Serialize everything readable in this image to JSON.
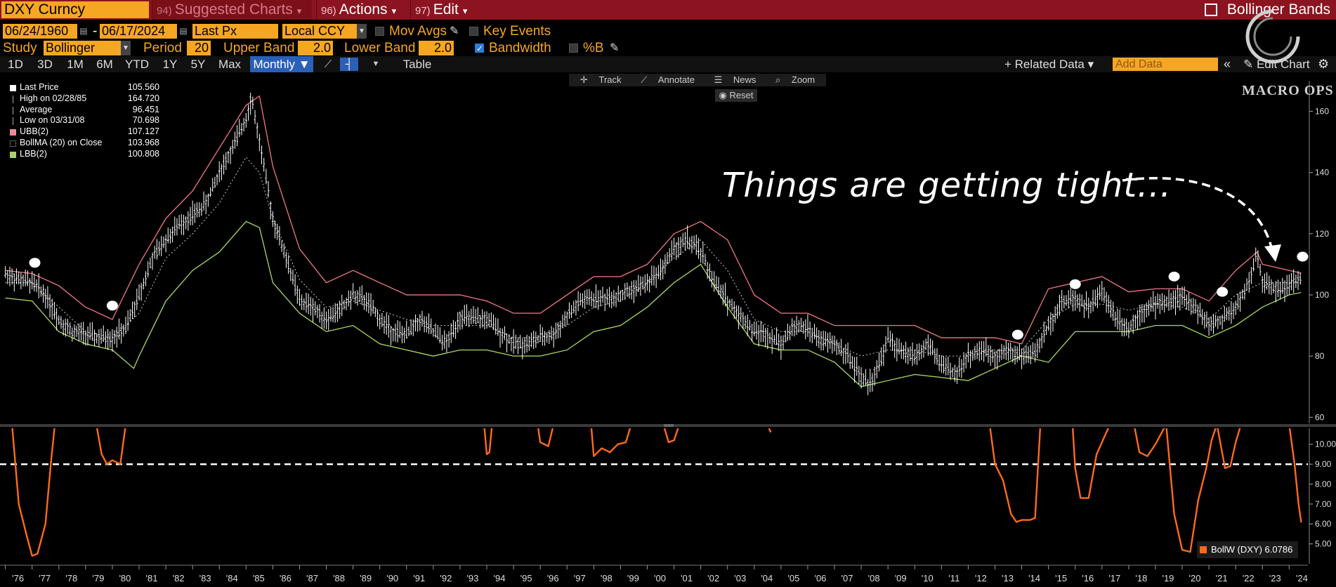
{
  "header": {
    "ticker": "DXY Curncy",
    "suggested": {
      "num": "94)",
      "label": "Suggested Charts"
    },
    "actions": {
      "num": "96)",
      "label": "Actions"
    },
    "edit": {
      "num": "97)",
      "label": "Edit"
    },
    "study_title": "Bollinger Bands"
  },
  "settings": {
    "start_date": "06/24/1960",
    "dash": "-",
    "end_date": "06/17/2024",
    "price_field": "Last Px",
    "currency": "Local CCY",
    "mov_avgs_label": "Mov Avgs",
    "key_events_label": "Key Events",
    "study_label": "Study",
    "study_value": "Bollinger",
    "period_label": "Period",
    "period_value": "20",
    "upper_label": "Upper Band",
    "upper_value": "2.0",
    "lower_label": "Lower Band",
    "lower_value": "2.0",
    "bandwidth_label": "Bandwidth",
    "pctb_label": "%B"
  },
  "toolbar": {
    "periods": [
      "1D",
      "3D",
      "1M",
      "6M",
      "YTD",
      "1Y",
      "5Y",
      "Max"
    ],
    "frequency": "Monthly ▼",
    "table_label": "Table",
    "related_data": "+ Related Data ▾",
    "add_data_placeholder": "Add Data",
    "edit_chart": "Edit Chart",
    "dbl_chevron": "«",
    "gear": "⚙"
  },
  "chart_tools": {
    "track": "Track",
    "annotate": "Annotate",
    "news": "News",
    "zoom": "Zoom",
    "reset": "Reset"
  },
  "legend": [
    {
      "label": "Last Price",
      "value": "105.560",
      "color": "#ffffff"
    },
    {
      "label": "High on 02/28/85",
      "value": "164.720",
      "color": "#ffffff"
    },
    {
      "label": "Average",
      "value": "96.451",
      "color": "#ffffff"
    },
    {
      "label": "Low on 03/31/08",
      "value": "70.698",
      "color": "#ffffff"
    },
    {
      "label": "UBB(2)",
      "value": "107.127",
      "color": "#f08a94"
    },
    {
      "label": "BollMA (20)  on Close",
      "value": "103.968",
      "color": "#bbbbbb"
    },
    {
      "label": "LBB(2)",
      "value": "100.808",
      "color": "#a8d36a"
    }
  ],
  "watermark": "MACRO OPS",
  "annotation": "Things are getting tight...",
  "bw_legend": {
    "label": "BollW (DXY) 6.0786",
    "color": "#ff6a1a"
  },
  "chart_data": {
    "type": "line",
    "title": "",
    "x_ticks": [
      "'76",
      "'77",
      "'78",
      "'79",
      "'80",
      "'81",
      "'82",
      "'83",
      "'84",
      "'85",
      "'86",
      "'87",
      "'88",
      "'89",
      "'90",
      "'91",
      "'92",
      "'93",
      "'94",
      "'95",
      "'96",
      "'97",
      "'98",
      "'99",
      "'00",
      "'01",
      "'02",
      "'03",
      "'04",
      "'05",
      "'06",
      "'07",
      "'08",
      "'09",
      "'10",
      "'11",
      "'12",
      "'13",
      "'14",
      "'15",
      "'16",
      "'17",
      "'18",
      "'19",
      "'20",
      "'21",
      "'22",
      "'23",
      "'24"
    ],
    "x_range": [
      1975.8,
      2024.7
    ],
    "price_panel": {
      "ylim": [
        58,
        170
      ],
      "y_ticks": [
        60,
        80,
        100,
        120,
        140,
        160
      ],
      "series": [
        {
          "name": "Last Price",
          "x": [
            1976.0,
            1976.5,
            1977.0,
            1977.5,
            1978.0,
            1978.5,
            1979.0,
            1979.5,
            1980.0,
            1980.5,
            1981.0,
            1981.5,
            1982.0,
            1982.5,
            1983.0,
            1983.5,
            1984.0,
            1984.5,
            1985.0,
            1985.2,
            1985.5,
            1986.0,
            1986.5,
            1987.0,
            1987.5,
            1988.0,
            1988.5,
            1989.0,
            1989.5,
            1990.0,
            1990.5,
            1991.0,
            1991.5,
            1992.0,
            1992.5,
            1993.0,
            1993.5,
            1994.0,
            1994.5,
            1995.0,
            1995.5,
            1996.0,
            1996.5,
            1997.0,
            1997.5,
            1998.0,
            1998.5,
            1999.0,
            1999.5,
            2000.0,
            2000.5,
            2001.0,
            2001.5,
            2002.0,
            2002.5,
            2003.0,
            2003.5,
            2004.0,
            2004.5,
            2005.0,
            2005.5,
            2006.0,
            2006.5,
            2007.0,
            2007.5,
            2008.0,
            2008.3,
            2008.8,
            2009.0,
            2009.5,
            2010.0,
            2010.5,
            2011.0,
            2011.5,
            2012.0,
            2012.5,
            2013.0,
            2013.5,
            2014.0,
            2014.5,
            2015.0,
            2015.5,
            2016.0,
            2016.5,
            2017.0,
            2017.5,
            2018.0,
            2018.5,
            2019.0,
            2019.5,
            2020.0,
            2020.5,
            2021.0,
            2021.5,
            2022.0,
            2022.5,
            2022.8,
            2023.0,
            2023.5,
            2024.0,
            2024.45
          ],
          "y": [
            107,
            105,
            104,
            100,
            92,
            88,
            87,
            86,
            86,
            89,
            100,
            112,
            118,
            123,
            126,
            130,
            140,
            148,
            158,
            164.7,
            150,
            125,
            112,
            98,
            96,
            92,
            95,
            100,
            98,
            92,
            88,
            87,
            92,
            88,
            84,
            93,
            92,
            92,
            88,
            84,
            84,
            86,
            87,
            93,
            98,
            99,
            99,
            100,
            102,
            104,
            108,
            115,
            118,
            114,
            104,
            98,
            93,
            88,
            87,
            84,
            90,
            89,
            85,
            84,
            80,
            73,
            70.7,
            80,
            86,
            81,
            80,
            84,
            77,
            74,
            80,
            82,
            80,
            82,
            80,
            81,
            90,
            98,
            99,
            96,
            101,
            93,
            89,
            95,
            97,
            98,
            99,
            96,
            90,
            92,
            96,
            104,
            114,
            104,
            102,
            103,
            105.56
          ]
        },
        {
          "name": "UBB(2)",
          "x": [
            1976,
            1977,
            1978,
            1979,
            1980,
            1981,
            1982,
            1983,
            1984,
            1985,
            1985.5,
            1986,
            1987,
            1988,
            1989,
            1990,
            1991,
            1992,
            1993,
            1994,
            1995,
            1996,
            1997,
            1998,
            1999,
            2000,
            2001,
            2002,
            2003,
            2004,
            2005,
            2006,
            2007,
            2008,
            2009,
            2010,
            2011,
            2012,
            2013,
            2014,
            2015,
            2016,
            2017,
            2018,
            2019,
            2020,
            2021,
            2022,
            2022.8,
            2023,
            2024,
            2024.45
          ],
          "y": [
            108,
            107,
            103,
            96,
            92,
            110,
            125,
            134,
            148,
            162,
            165,
            142,
            115,
            104,
            108,
            104,
            100,
            100,
            100,
            98,
            94,
            94,
            100,
            106,
            106,
            110,
            120,
            124,
            118,
            100,
            94,
            94,
            90,
            90,
            90,
            90,
            86,
            86,
            86,
            84,
            102,
            104,
            106,
            101,
            102,
            102,
            98,
            108,
            114,
            110,
            108,
            107.1
          ]
        },
        {
          "name": "BollMA (20)",
          "x": [
            1976,
            1977,
            1978,
            1979,
            1980,
            1981,
            1982,
            1983,
            1984,
            1985,
            1985.5,
            1986,
            1987,
            1988,
            1989,
            1990,
            1991,
            1992,
            1993,
            1994,
            1995,
            1996,
            1997,
            1998,
            1999,
            2000,
            2001,
            2002,
            2003,
            2004,
            2005,
            2006,
            2007,
            2008,
            2009,
            2010,
            2011,
            2012,
            2013,
            2014,
            2015,
            2016,
            2017,
            2018,
            2019,
            2020,
            2021,
            2022,
            2023,
            2024,
            2024.45
          ],
          "y": [
            104,
            104,
            96,
            88,
            86,
            94,
            112,
            120,
            130,
            145,
            140,
            125,
            105,
            96,
            98,
            95,
            92,
            90,
            90,
            90,
            86,
            86,
            90,
            96,
            98,
            104,
            112,
            118,
            108,
            92,
            88,
            88,
            84,
            80,
            82,
            82,
            80,
            80,
            82,
            82,
            92,
            97,
            97,
            95,
            97,
            96,
            92,
            100,
            104,
            104,
            104.0
          ]
        },
        {
          "name": "LBB(2)",
          "x": [
            1976,
            1977,
            1978,
            1979,
            1980,
            1980.8,
            1981,
            1982,
            1983,
            1984,
            1985,
            1985.5,
            1986,
            1987,
            1988,
            1989,
            1990,
            1991,
            1992,
            1993,
            1994,
            1995,
            1996,
            1997,
            1998,
            1999,
            2000,
            2001,
            2002,
            2003,
            2004,
            2005,
            2006,
            2007,
            2008,
            2009,
            2010,
            2011,
            2012,
            2013,
            2014,
            2015,
            2016,
            2017,
            2018,
            2019,
            2020,
            2021,
            2022,
            2023,
            2024,
            2024.45
          ],
          "y": [
            99,
            98,
            88,
            84,
            82,
            76,
            80,
            98,
            108,
            114,
            124,
            122,
            104,
            94,
            88,
            90,
            84,
            82,
            80,
            82,
            82,
            80,
            80,
            82,
            88,
            90,
            96,
            104,
            110,
            96,
            84,
            82,
            82,
            78,
            70,
            72,
            74,
            73,
            72,
            76,
            80,
            78,
            88,
            88,
            88,
            90,
            90,
            86,
            90,
            96,
            100,
            100.8
          ]
        }
      ],
      "markers": [
        {
          "x": 1977.1,
          "y": 110.5
        },
        {
          "x": 1980.0,
          "y": 96.5
        },
        {
          "x": 2013.85,
          "y": 87
        },
        {
          "x": 2016.0,
          "y": 103.5
        },
        {
          "x": 2019.7,
          "y": 106
        },
        {
          "x": 2021.5,
          "y": 101
        },
        {
          "x": 2024.5,
          "y": 112.5
        }
      ]
    },
    "bandwidth_panel": {
      "ylim": [
        4,
        10.8
      ],
      "y_ticks": [
        "5.00",
        "6.00",
        "7.00",
        "8.00",
        "9.00",
        "10.00"
      ],
      "threshold": 9.0,
      "series": [
        {
          "name": "BollW (DXY)",
          "segments": [
            {
              "x": [
                1976.25,
                1976.5,
                1976.8,
                1977.0,
                1977.2,
                1977.5,
                1977.7,
                1977.85
              ],
              "y": [
                11,
                7,
                5.4,
                4.4,
                4.5,
                6,
                9,
                11
              ]
            },
            {
              "x": [
                1979.4,
                1979.6,
                1979.8,
                1980.0,
                1980.3,
                1980.5
              ],
              "y": [
                11,
                9.5,
                9.0,
                9.2,
                9.0,
                11
              ]
            },
            {
              "x": [
                1993.9,
                1994.0,
                1994.1,
                1994.2
              ],
              "y": [
                11,
                9.5,
                9.6,
                11
              ]
            },
            {
              "x": [
                1995.9,
                1996.0,
                1996.3,
                1996.5
              ],
              "y": [
                11,
                10.1,
                9.9,
                11
              ]
            },
            {
              "x": [
                1997.9,
                1998.0,
                1998.3,
                1998.6,
                1998.9,
                1999.2,
                1999.4
              ],
              "y": [
                11,
                9.4,
                9.8,
                9.6,
                10.0,
                10.1,
                11
              ]
            },
            {
              "x": [
                2000.6,
                2000.8,
                2001.0,
                2001.2
              ],
              "y": [
                11,
                10.1,
                10.2,
                11
              ]
            },
            {
              "x": [
                2004.55,
                2004.62
              ],
              "y": [
                10.8,
                10.6
              ]
            },
            {
              "x": [
                2012.8,
                2013.0,
                2013.3,
                2013.6,
                2013.8,
                2014.0,
                2014.3,
                2014.5,
                2014.7
              ],
              "y": [
                11,
                9.0,
                8.2,
                6.5,
                6.1,
                6.2,
                6.2,
                6.3,
                11
              ]
            },
            {
              "x": [
                2015.9,
                2016.0,
                2016.2,
                2016.5,
                2016.8,
                2017.0,
                2017.3
              ],
              "y": [
                11,
                8.8,
                7.3,
                7.3,
                9.5,
                10.1,
                11
              ]
            },
            {
              "x": [
                2018.2,
                2018.4,
                2018.7,
                2019.0,
                2019.4
              ],
              "y": [
                11,
                9.6,
                9.4,
                10.0,
                11
              ]
            },
            {
              "x": [
                2019.4,
                2019.7,
                2020.0,
                2020.3,
                2020.6,
                2020.9,
                2021.1,
                2021.3
              ],
              "y": [
                11,
                6.5,
                4.7,
                4.6,
                7.2,
                8.8,
                10.2,
                11
              ]
            },
            {
              "x": [
                2021.3,
                2021.6,
                2021.8,
                2022.0,
                2022.2
              ],
              "y": [
                11,
                8.8,
                8.9,
                10.1,
                11
              ]
            },
            {
              "x": [
                2024.0,
                2024.2,
                2024.35,
                2024.45
              ],
              "y": [
                11,
                9.0,
                7.0,
                6.08
              ]
            }
          ]
        }
      ]
    }
  }
}
